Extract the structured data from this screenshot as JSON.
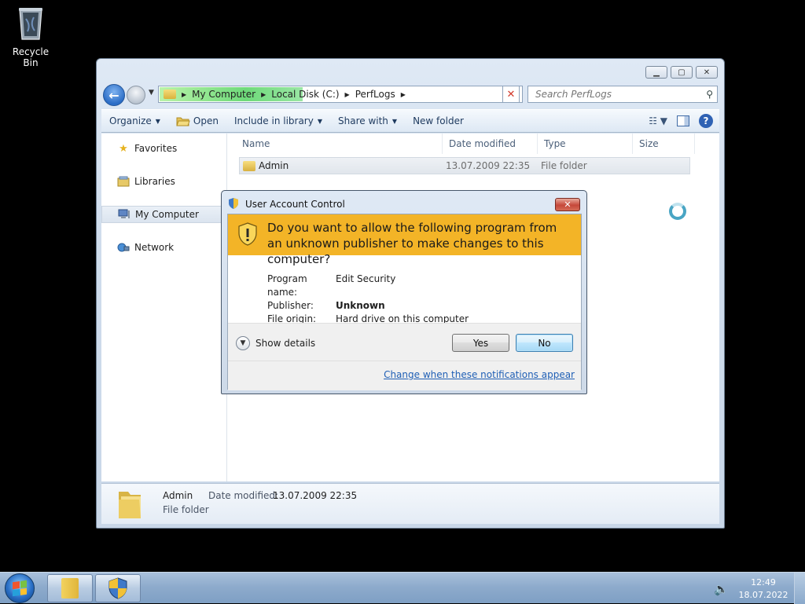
{
  "desktop": {
    "recycle_bin_label": "Recycle Bin"
  },
  "explorer": {
    "address": {
      "crumbs": [
        "My Computer",
        "Local Disk (C:)",
        "PerfLogs"
      ]
    },
    "search": {
      "placeholder": "Search PerfLogs"
    },
    "toolbar": {
      "organize": "Organize",
      "open": "Open",
      "include_in_library": "Include in library",
      "share_with": "Share with",
      "new_folder": "New folder"
    },
    "nav": {
      "favorites": "Favorites",
      "libraries": "Libraries",
      "my_computer": "My Computer",
      "network": "Network"
    },
    "columns": {
      "name": "Name",
      "date_modified": "Date modified",
      "type": "Type",
      "size": "Size"
    },
    "files": [
      {
        "name": "Admin",
        "date_modified": "13.07.2009 22:35",
        "type": "File folder"
      }
    ],
    "details": {
      "name": "Admin",
      "type": "File folder",
      "date_label": "Date modified:",
      "date_value": "13.07.2009 22:35"
    }
  },
  "uac": {
    "title": "User Account Control",
    "question": "Do you want to allow the following program from an unknown publisher to make changes to this computer?",
    "program_name_label": "Program name:",
    "program_name": "Edit Security",
    "publisher_label": "Publisher:",
    "publisher": "Unknown",
    "file_origin_label": "File origin:",
    "file_origin": "Hard drive on this computer",
    "show_details": "Show details",
    "yes": "Yes",
    "no": "No",
    "change_link": "Change when these notifications appear",
    "banner_color": "#f3b427"
  },
  "taskbar": {
    "time": "12:49",
    "date": "18.07.2022"
  }
}
